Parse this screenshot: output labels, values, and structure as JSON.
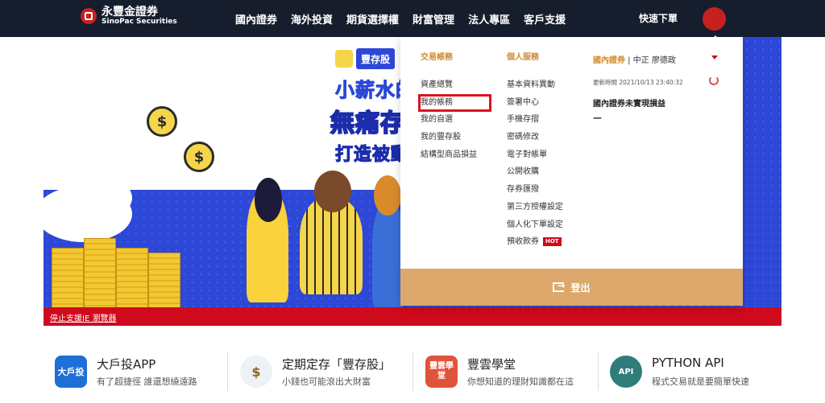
{
  "header": {
    "logo_zh": "永豐金證券",
    "logo_en": "SinoPac Securities",
    "nav": [
      "國內證券",
      "海外投資",
      "期貨選擇權",
      "財富管理",
      "法人專區",
      "客戶支援"
    ],
    "quick_order": "快速下單"
  },
  "hero": {
    "badge": "豐存股",
    "line1": "小薪水的",
    "line2": "無痛存",
    "line3": "打造被動"
  },
  "notice": {
    "ie_link": "停止支援IE 瀏覽器"
  },
  "menu": {
    "col1": {
      "title": "交易帳務",
      "items": [
        "資產總覽",
        "我的帳務",
        "我的自選",
        "我的豐存股",
        "結構型商品損益"
      ]
    },
    "col2": {
      "title": "個人服務",
      "items": [
        "基本資料異動",
        "簽署中心",
        "手機存摺",
        "密碼修改",
        "電子對帳單",
        "公開收購",
        "存券匯撥",
        "第三方授權設定",
        "個人化下單設定",
        "預收款券"
      ],
      "hot_badge": "HOT"
    },
    "account": {
      "brand": "國內證券",
      "separator": " | ",
      "user": "中正 廖德政",
      "update_time": "更新時間 2021/10/13 23:40:32",
      "unrealized_label": "國內證券未實現損益",
      "unrealized_value": "—"
    },
    "logout": "登出"
  },
  "features": [
    {
      "title": "大戶投APP",
      "desc": "有了超捷徑 誰還想繞遠路",
      "icon_text": "大戶投",
      "color": "#1e6fd6"
    },
    {
      "title": "定期定存「豐存股」",
      "desc": "小錢也可能滾出大財富",
      "icon_text": "$",
      "color": "#ffffff"
    },
    {
      "title": "豐雲學堂",
      "desc": "你想知道的理財知識都在這",
      "icon_text": "豐雲學堂",
      "color": "#e0533b"
    },
    {
      "title": "PYTHON API",
      "desc": "程式交易就是要簡單快速",
      "icon_text": "API",
      "color": "#2f7d7a"
    }
  ],
  "colors": {
    "topbar": "#161e2e",
    "brand_red": "#cf0a1c",
    "gold": "#dca86b",
    "hero_blue": "#2d47d6"
  }
}
